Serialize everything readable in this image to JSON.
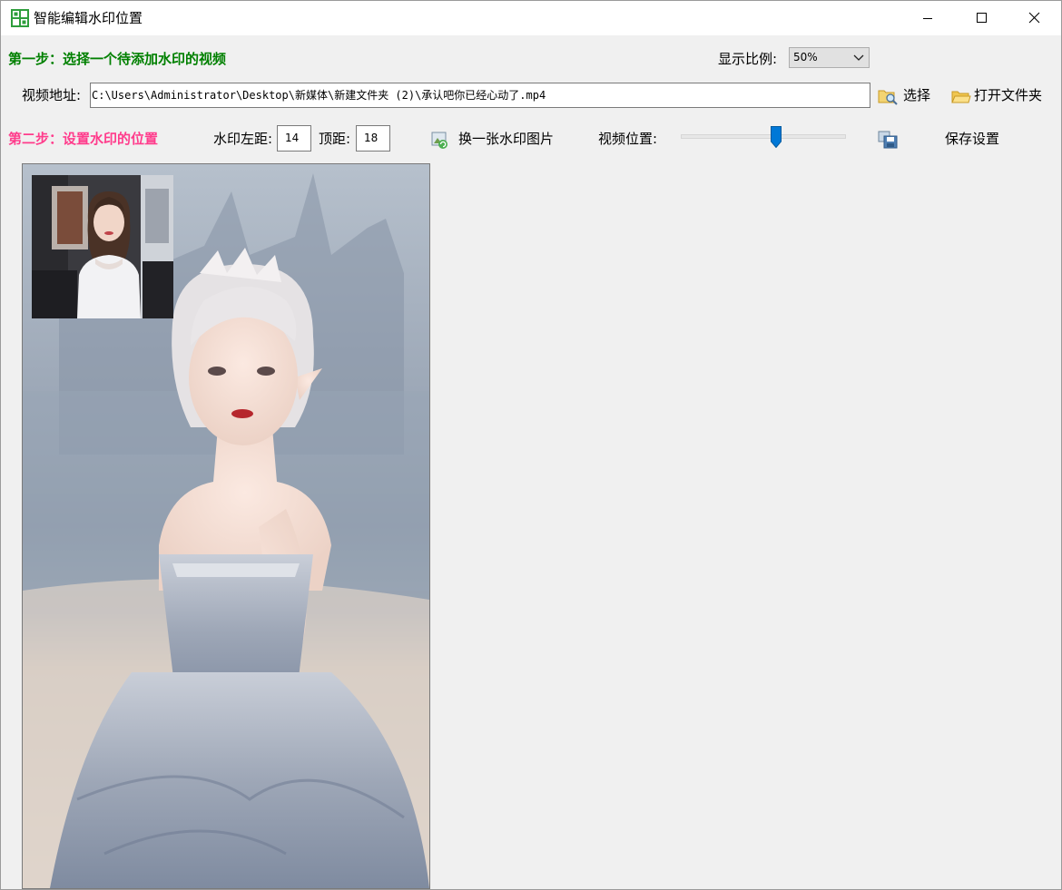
{
  "window": {
    "title": "智能编辑水印位置",
    "icon": "app-logo-icon",
    "controls": [
      "minimize-icon",
      "maximize-icon",
      "close-icon"
    ]
  },
  "step1": {
    "label": "第一步：选择一个待添加水印的视频",
    "color": "#008000"
  },
  "display_ratio": {
    "label": "显示比例:",
    "value": "50%"
  },
  "video": {
    "label": "视频地址:",
    "path": "C:\\Users\\Administrator\\Desktop\\新媒体\\新建文件夹 (2)\\承认吧你已经心动了.mp4",
    "select_label": "选择",
    "open_folder_label": "打开文件夹"
  },
  "step2": {
    "label": "第二步：设置水印的位置",
    "color": "#ff3c8c"
  },
  "watermark": {
    "left_label": "水印左距:",
    "left_value": "14",
    "top_label": "顶距:",
    "top_value": "18",
    "change_image_label": "换一张水印图片"
  },
  "video_position": {
    "label": "视频位置:",
    "value_fraction": 0.59
  },
  "save_label": "保存设置"
}
